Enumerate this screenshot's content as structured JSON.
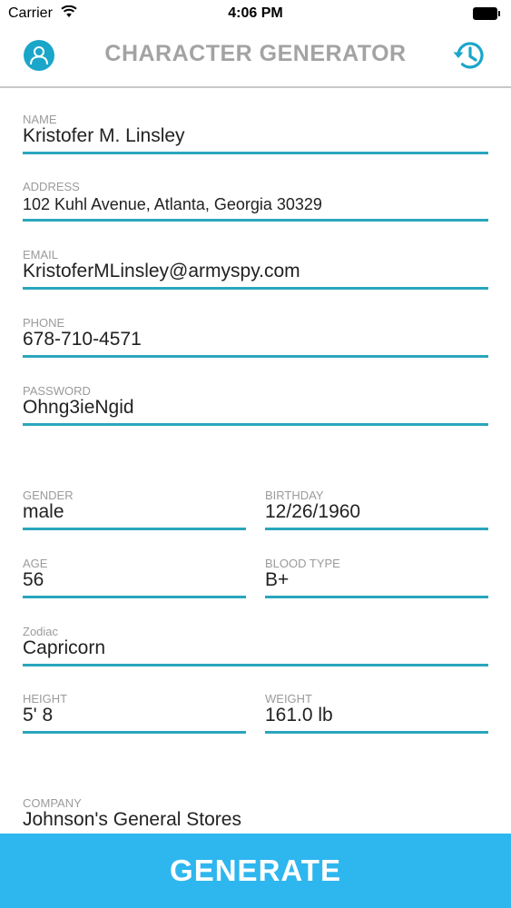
{
  "status_bar": {
    "carrier": "Carrier",
    "time": "4:06 PM"
  },
  "nav": {
    "title": "CHARACTER GENERATOR",
    "left_icon": "person-icon",
    "right_icon": "history-icon"
  },
  "fields": {
    "name": {
      "label": "NAME",
      "value": "Kristofer M. Linsley"
    },
    "address": {
      "label": "ADDRESS",
      "value": "102 Kuhl Avenue, Atlanta, Georgia 30329"
    },
    "email": {
      "label": "EMAIL",
      "value": "KristoferMLinsley@armyspy.com"
    },
    "phone": {
      "label": "PHONE",
      "value": "678-710-4571"
    },
    "password": {
      "label": "PASSWORD",
      "value": "Ohng3ieNgid"
    },
    "gender": {
      "label": "GENDER",
      "value": "male"
    },
    "birthday": {
      "label": "BIRTHDAY",
      "value": "12/26/1960"
    },
    "age": {
      "label": "AGE",
      "value": "56"
    },
    "blood_type": {
      "label": "BLOOD TYPE",
      "value": "B+"
    },
    "zodiac": {
      "label": "Zodiac",
      "value": "Capricorn"
    },
    "height": {
      "label": "HEIGHT",
      "value": "5' 8"
    },
    "weight": {
      "label": "WEIGHT",
      "value": "161.0 lb"
    },
    "company": {
      "label": "COMPANY",
      "value": "Johnson's General Stores"
    }
  },
  "generate_button": {
    "label": "GENERATE"
  },
  "colors": {
    "accent": "#2aa6bd",
    "button": "#2eb6ef",
    "title": "#a3a3a3",
    "label": "#9b9b9b"
  }
}
